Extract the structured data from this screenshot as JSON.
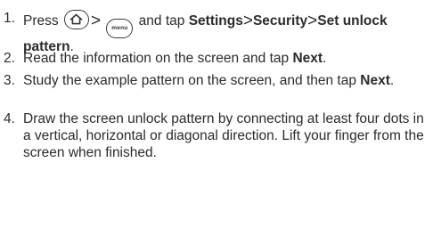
{
  "steps": [
    {
      "number": "1.",
      "press": "Press",
      "home_icon": "home-icon",
      "sep1": ">",
      "menu_key_label": "menu",
      "and_tap": "and tap",
      "settings": "Settings",
      "sep2": ">",
      "security": "Security",
      "sep3": ">",
      "set_unlock_pattern_1": "Set",
      "set_unlock_pattern_2": "unlock pattern",
      "period": "."
    },
    {
      "number": "2.",
      "text": "Read the information on the screen and tap",
      "bold": "Next",
      "period": "."
    },
    {
      "number": "3.",
      "text": "Study the example pattern on the screen, and then tap",
      "bold": "Next",
      "period": "."
    },
    {
      "number": "4.",
      "text": "Draw the screen unlock pattern by connecting at least four dots in a vertical, horizontal or diagonal direction. Lift your finger from the screen when finished."
    }
  ]
}
